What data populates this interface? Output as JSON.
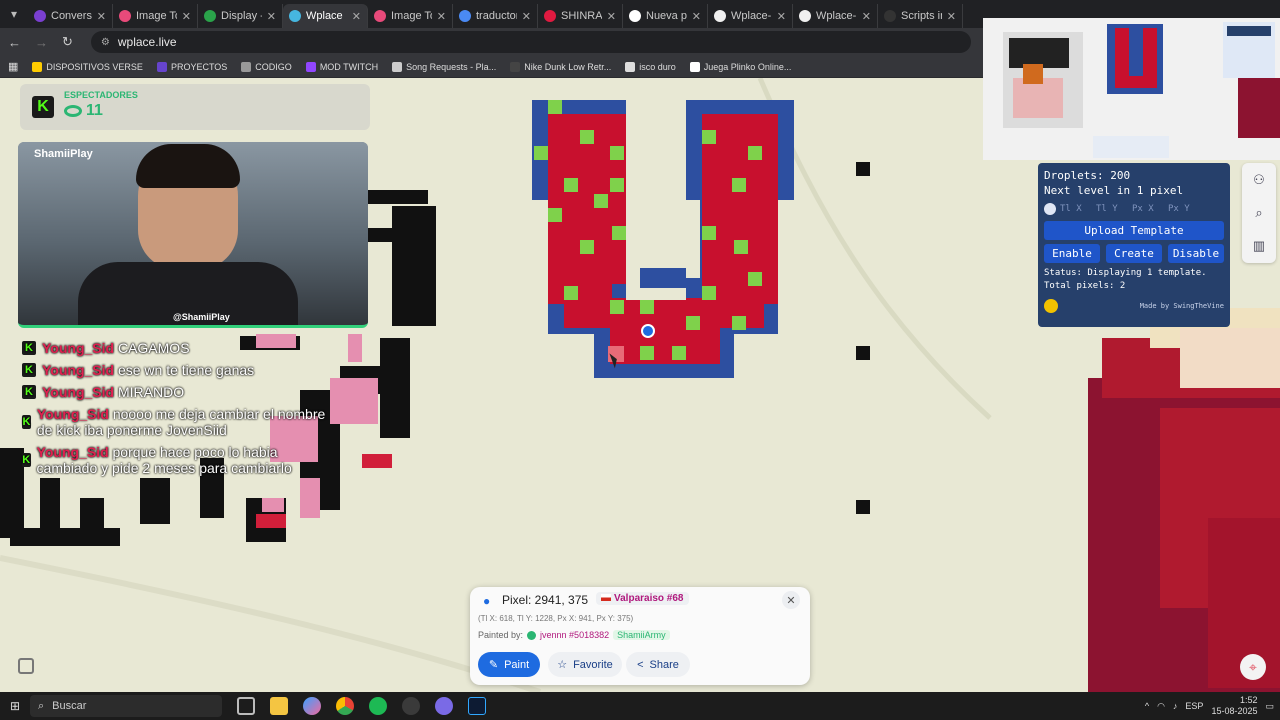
{
  "browser": {
    "tabs": [
      {
        "label": "Conversor",
        "color": "#7a3fd1",
        "active": false
      },
      {
        "label": "Image To",
        "color": "#e84a7a",
        "active": false
      },
      {
        "label": "Display - ",
        "color": "#2aa34a",
        "active": false
      },
      {
        "label": "Wplace",
        "color": "#46b6e0",
        "active": true
      },
      {
        "label": "Image To",
        "color": "#e84a7a",
        "active": false
      },
      {
        "label": "traductor",
        "color": "#4a8af4",
        "active": false
      },
      {
        "label": "SHINRA T",
        "color": "#e01a40",
        "active": false
      },
      {
        "label": "Nueva pe",
        "color": "#ffffff",
        "active": false
      },
      {
        "label": "Wplace-B",
        "color": "#f0f0f0",
        "active": false
      },
      {
        "label": "Wplace-B",
        "color": "#f0f0f0",
        "active": false
      },
      {
        "label": "Scripts in",
        "color": "#333333",
        "active": false
      }
    ],
    "url": "wplace.live",
    "bookmarks": [
      "DISPOSITIVOS VERSE",
      "PROYECTOS",
      "CODIGO",
      "MOD TWITCH",
      "Song Requests - Pla...",
      "Nike Dunk Low Retr...",
      "isco duro",
      "Juega Plinko Online..."
    ]
  },
  "overlay": {
    "viewers_label": "ESPECTADORES",
    "viewers_count": "11",
    "webcam_name": "ShamiiPlay",
    "tiktok_handle": "@ShamiiPlay",
    "chat": [
      {
        "user": "Young_Sid",
        "msg": "CAGAMOS"
      },
      {
        "user": "Young_Sid",
        "msg": "ese wn te tiene ganas"
      },
      {
        "user": "Young_Sid",
        "msg": "MIRANDO"
      },
      {
        "user": "Young_Sid",
        "msg": "noooo me deja cambiar el nombre de kick iba ponerme JovenSiid"
      },
      {
        "user": "Young_Sid",
        "msg": "porque hace poco lo habia cambiado y pide 2 meses para cambiarlo"
      }
    ]
  },
  "template_panel": {
    "droplets": "Droplets: 200",
    "next_level": "Next level in 1 pixel",
    "coord_fields": [
      "Tl X",
      "Tl Y",
      "Px X",
      "Px Y"
    ],
    "upload": "Upload Template",
    "enable": "Enable",
    "create": "Create",
    "disable": "Disable",
    "status": "Status: Displaying 1 template.",
    "total": "Total pixels: 2",
    "made_by": "Made by SwingTheVine"
  },
  "pixel_card": {
    "pixel": "Pixel: 2941, 375",
    "region": "Valparaiso #68",
    "coords": "(Tl X: 618, Tl Y: 1228, Px X: 941, Px Y: 375)",
    "painted_by_label": "Painted by:",
    "painter": "jvennn #5018382",
    "alliance": "ShamiiArmy",
    "paint": "Paint",
    "favorite": "Favorite",
    "share": "Share"
  },
  "taskbar": {
    "search": "Buscar",
    "lang": "ESP",
    "time": "1:52",
    "date": "15-08-2025"
  },
  "colors": {
    "u_red": "#c8102e",
    "u_blue": "#2d4fa0",
    "u_green": "#7fd14b",
    "canvas_bg": "#e8e8d4",
    "accent": "#1e6be0"
  }
}
